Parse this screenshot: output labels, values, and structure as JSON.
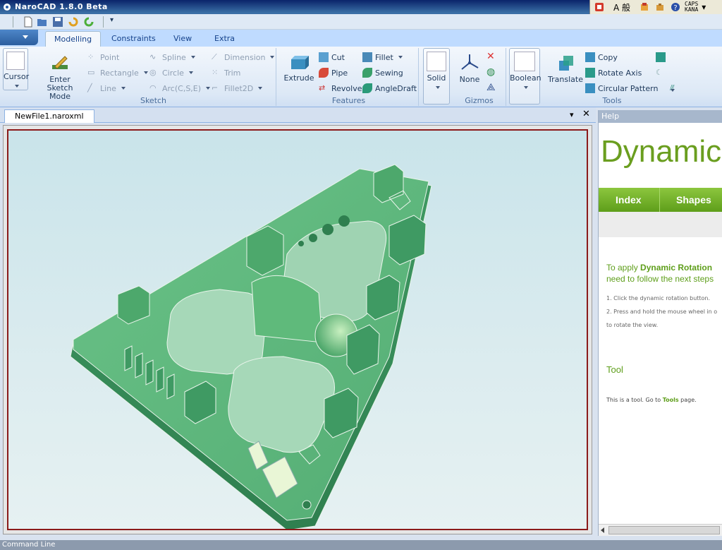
{
  "window": {
    "title": "NaroCAD 1.8.0 Beta",
    "ime_caps": "CAPS",
    "ime_kana": "KANA",
    "ime_mode": "A 般"
  },
  "tabs": [
    {
      "label": "Modelling",
      "active": true
    },
    {
      "label": "Constraints",
      "active": false
    },
    {
      "label": "View",
      "active": false
    },
    {
      "label": "Extra",
      "active": false
    }
  ],
  "ribbon": {
    "cursor": {
      "label": "Cursor"
    },
    "enter_sketch": {
      "line1": "Enter Sketch",
      "line2": "Mode"
    },
    "sketch": {
      "label": "Sketch",
      "point": "Point",
      "rectangle": "Rectangle",
      "line": "Line",
      "spline": "Spline",
      "circle": "Circle",
      "arc": "Arc(C,S,E)",
      "dimension": "Dimension",
      "trim": "Trim",
      "fillet2d": "Fillet2D"
    },
    "features": {
      "label": "Features",
      "extrude": "Extrude",
      "cut": "Cut",
      "pipe": "Pipe",
      "revolve": "Revolve",
      "fillet": "Fillet",
      "sewing": "Sewing",
      "angledraft": "AngleDraft"
    },
    "solid": {
      "label": "Solid"
    },
    "gizmos": {
      "label": "Gizmos",
      "none": "None"
    },
    "boolean": {
      "label": "Boolean"
    },
    "tools": {
      "label": "Tools",
      "translate": "Translate",
      "copy": "Copy",
      "rotate_axis": "Rotate Axis",
      "circular_pattern": "Circular Pattern"
    }
  },
  "document": {
    "tab_label": "NewFile1.naroxml",
    "menu_glyph": "▾",
    "close_glyph": "✕"
  },
  "help": {
    "header": "Help",
    "title": "Dynamic",
    "nav": [
      "Index",
      "Shapes"
    ],
    "intro_line1_prefix": "To apply ",
    "intro_line1_bold": "Dynamic Rotation",
    "intro_line2": "need to follow the next steps",
    "steps": [
      "1. Click the dynamic rotation button.",
      "2. Press and hold the mouse wheel in o",
      "to rotate the view."
    ],
    "tool_heading": "Tool",
    "tool_text_prefix": "This is a tool. Go to ",
    "tool_text_link": "Tools",
    "tool_text_suffix": " page."
  },
  "statusbar": {
    "command_line": "Command Line"
  },
  "colors": {
    "model_green": "#5fb87a",
    "help_green": "#6a9e1f",
    "viewport_border": "#8b1a1a"
  },
  "icons": {
    "app": "narocad-logo-icon",
    "new": "new-file-icon",
    "open": "open-file-icon",
    "save": "save-icon",
    "undo": "undo-icon",
    "redo": "redo-icon"
  }
}
